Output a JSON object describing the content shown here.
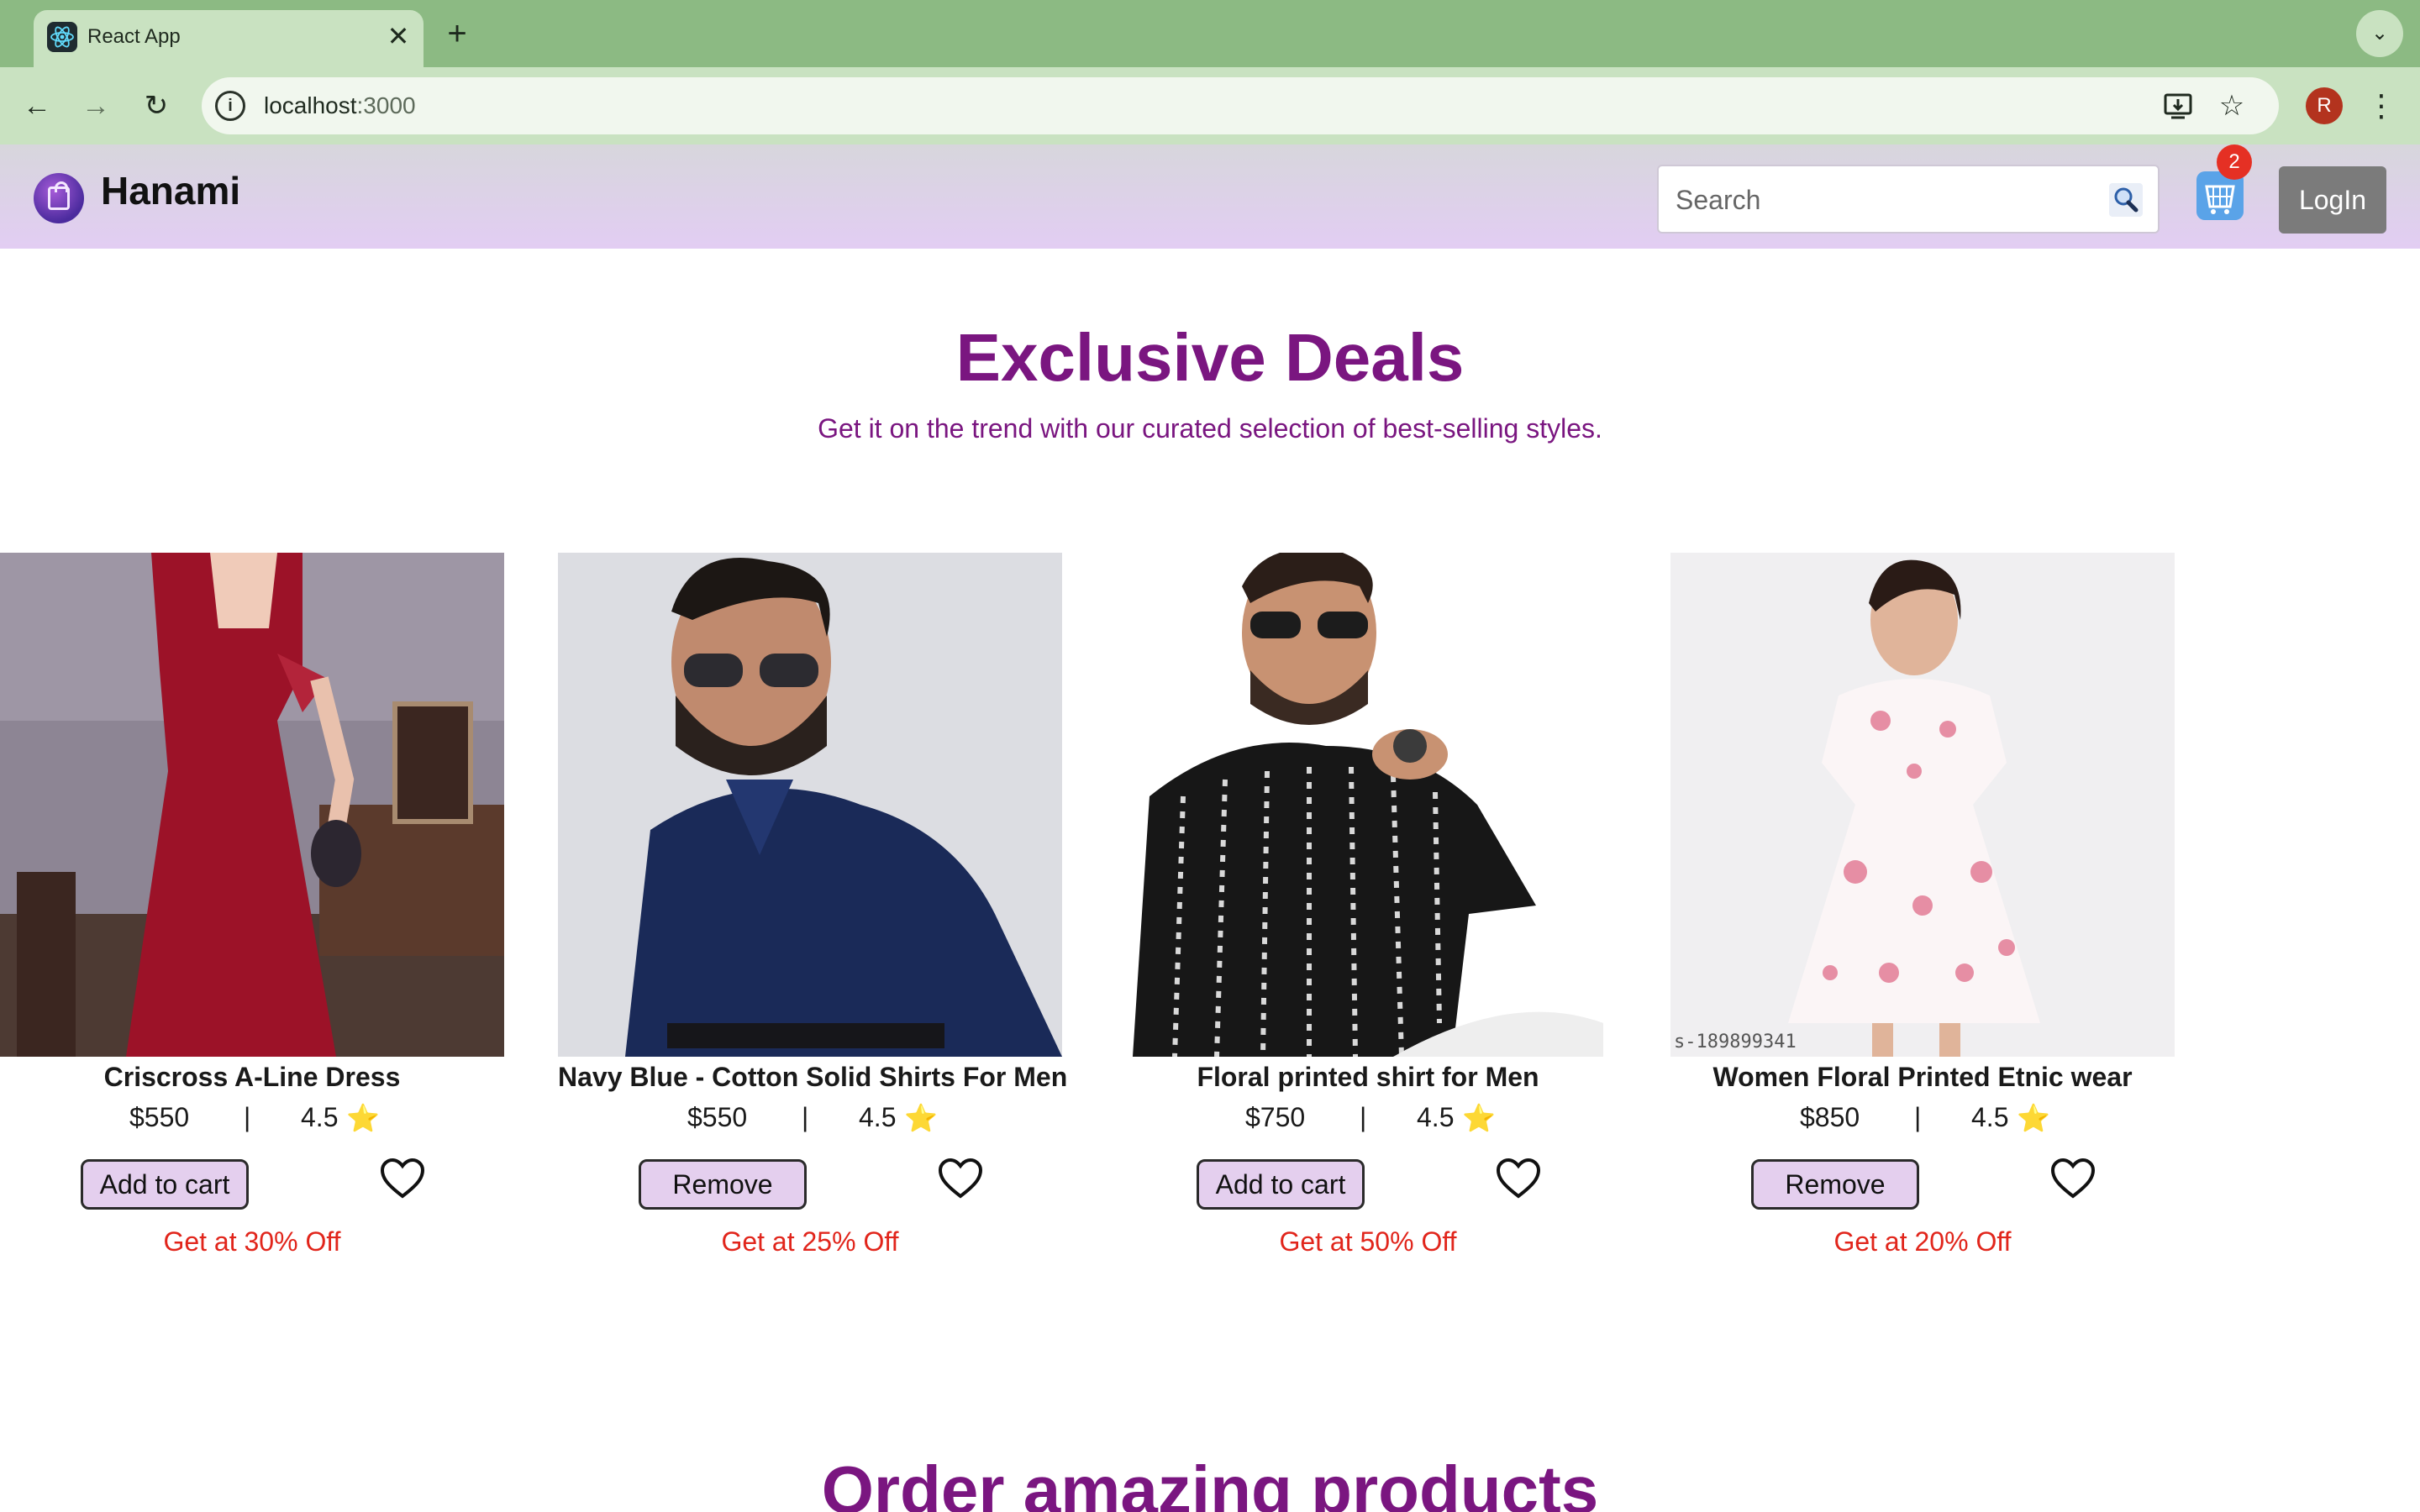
{
  "browser": {
    "tab_title": "React App",
    "tab_close": "✕",
    "new_tab": "+",
    "url_host": "localhost",
    "url_port": ":3000",
    "profile_initial": "R"
  },
  "header": {
    "brand": "Hanami",
    "search_placeholder": "Search",
    "cart_count": "2",
    "login_label": "LogIn"
  },
  "main": {
    "title": "Exclusive Deals",
    "subtitle": "Get it on the trend with our curated selection of best-selling styles.",
    "next_title": "Order amazing products"
  },
  "products": [
    {
      "name": "Criscross A-Line Dress",
      "price": "$550",
      "sep": "|",
      "rating": "4.5",
      "star": "⭐",
      "button": "Add to cart",
      "offer": "Get at 30% Off"
    },
    {
      "name": "Navy Blue - Cotton Solid Shirts For Men",
      "price": "$550",
      "sep": "|",
      "rating": "4.5",
      "star": "⭐",
      "button": "Remove",
      "offer": "Get at 25% Off"
    },
    {
      "name": "Floral printed shirt for Men",
      "price": "$750",
      "sep": "|",
      "rating": "4.5",
      "star": "⭐",
      "button": "Add to cart",
      "offer": "Get at 50% Off"
    },
    {
      "name": "Women Floral Printed Etnic wear",
      "price": "$850",
      "sep": "|",
      "rating": "4.5",
      "star": "⭐",
      "button": "Remove",
      "offer": "Get at 20% Off"
    }
  ],
  "image_overlay_text": "s-189899341",
  "colors": {
    "accent_purple": "#7a1680",
    "offer_red": "#e1251b",
    "tab_green": "#8cba83",
    "header_lavender": "#e2cdf3"
  }
}
